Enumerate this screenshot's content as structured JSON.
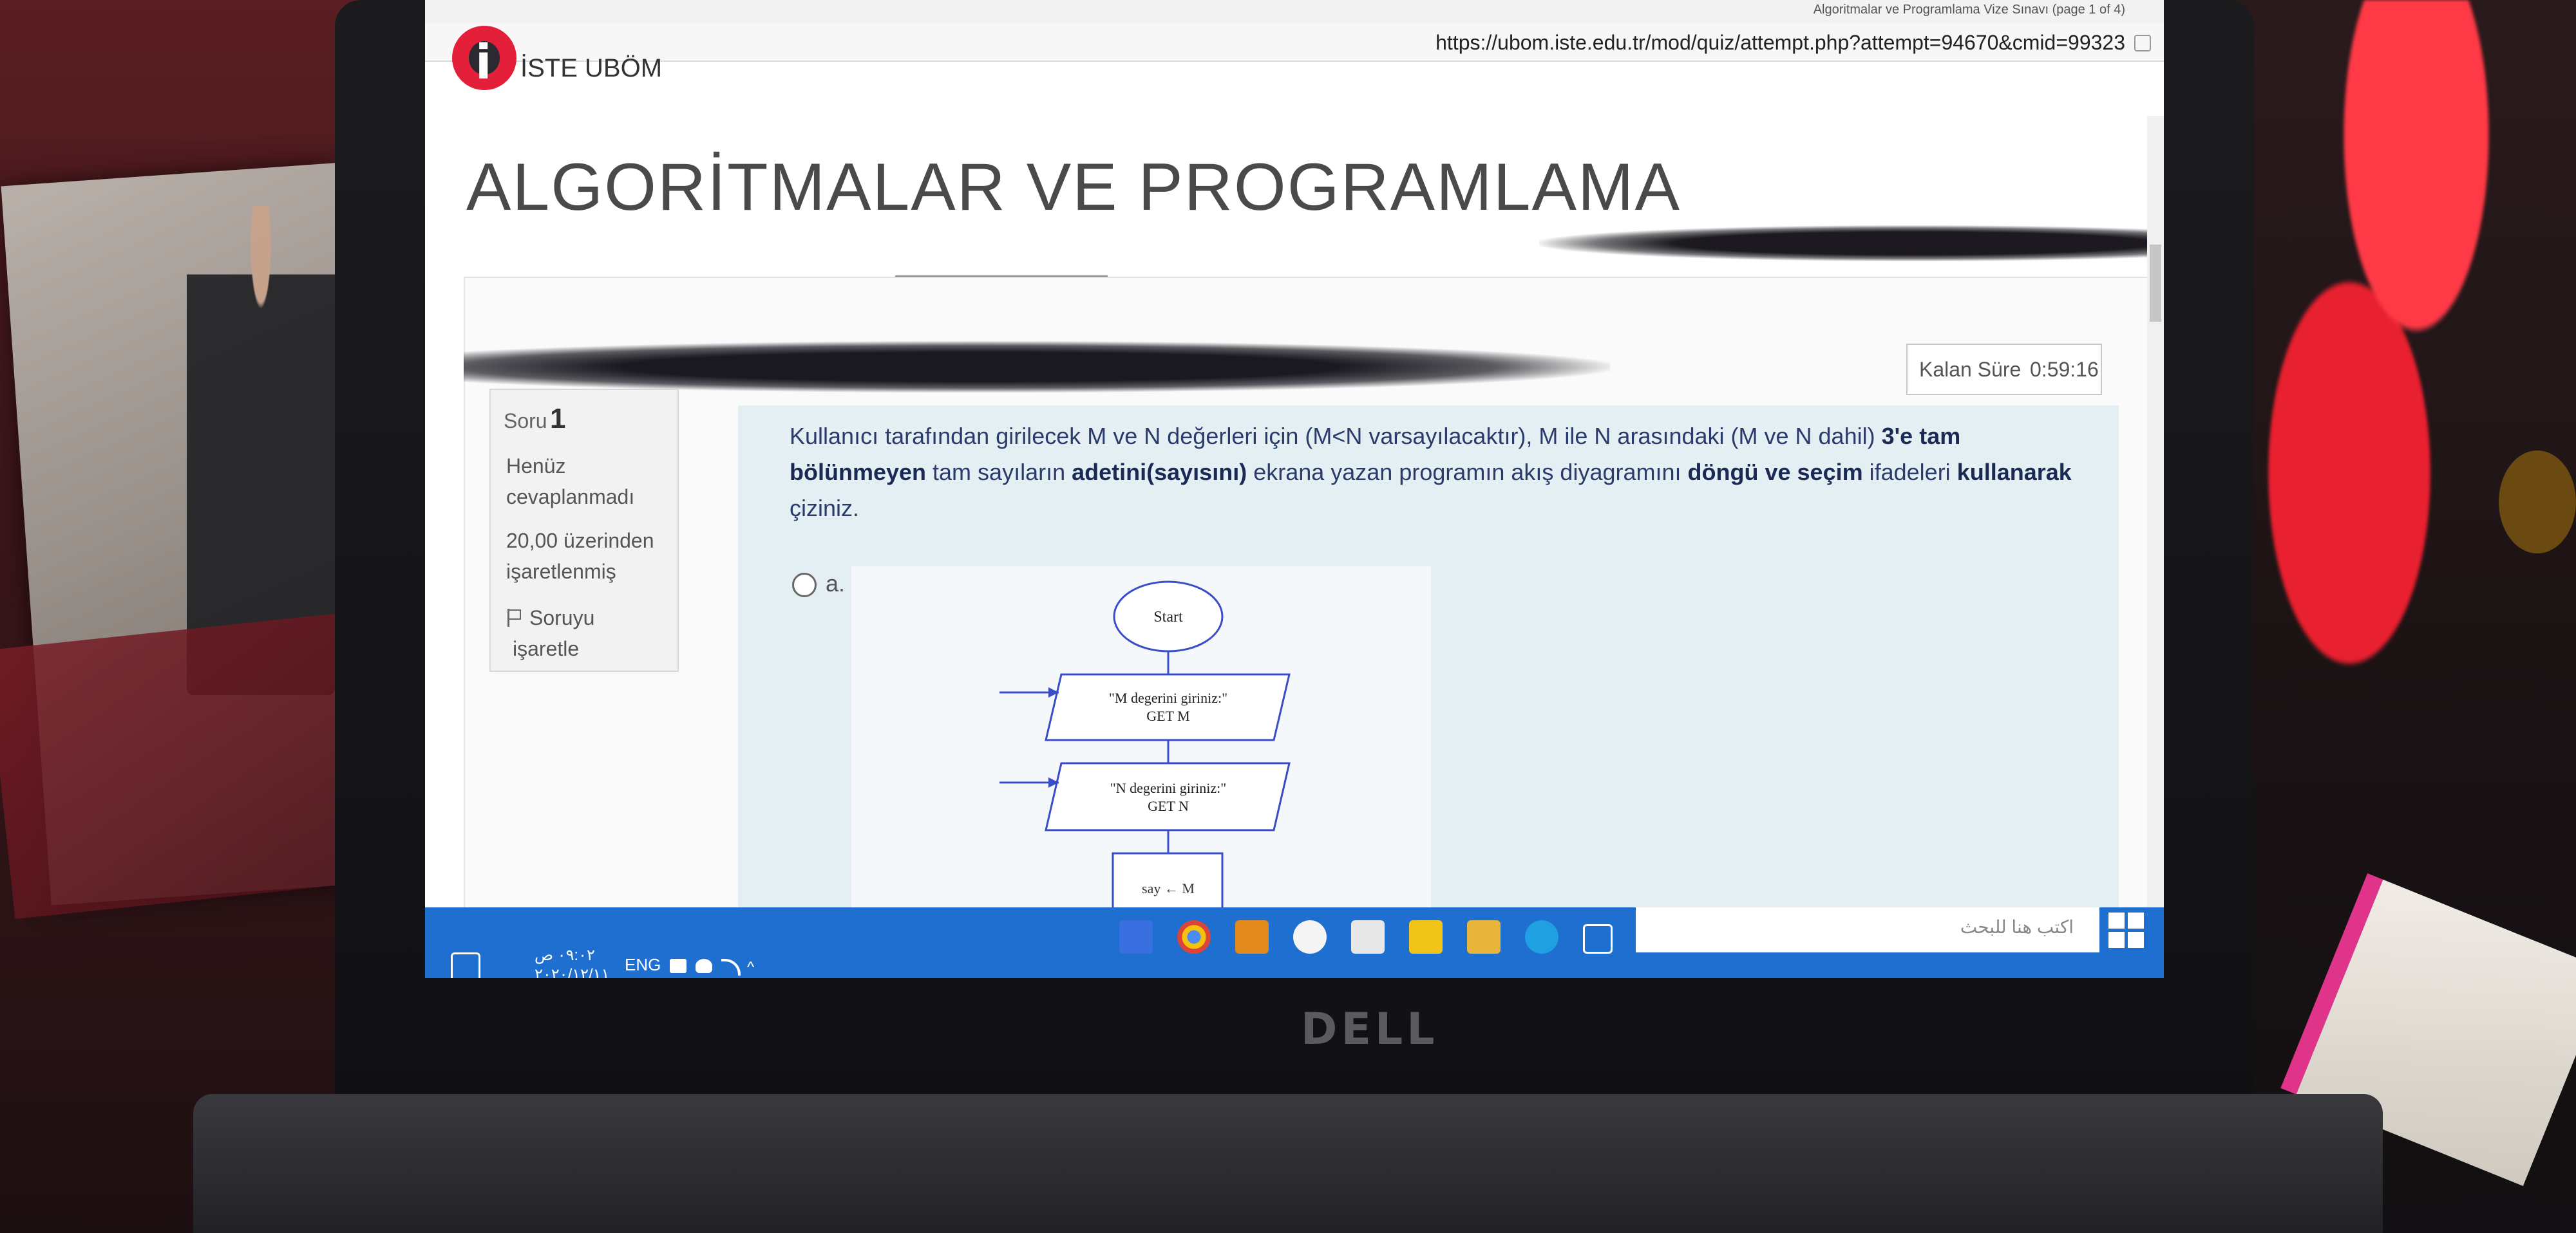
{
  "browser": {
    "tab_title": "Algoritmalar ve Programlama Vize Sınavı (page 1 of 4)",
    "url": "https://ubom.iste.edu.tr/mod/quiz/attempt.php?attempt=94670&cmid=99323"
  },
  "site": {
    "logo_letter": "i",
    "name": "İSTE UBÖM",
    "brand_color": "#e31f3a"
  },
  "course": {
    "title": "ALGORİTMALAR VE PROGRAMLAMA"
  },
  "timer": {
    "label": "Kalan Süre",
    "value": "0:59:16"
  },
  "question_info": {
    "word": "Soru",
    "number": "1",
    "status": "Henüz cevaplanmadı",
    "points": "20,00 üzerinden işaretlenmiş",
    "flag_label": "Soruyu işaretle"
  },
  "question": {
    "part1": "Kullanıcı tarafından girilecek M ve N değerleri için (M<N varsayılacaktır), M ile N arasındaki (M ve N dahil) ",
    "bold1": "3'e tam bölünmeyen",
    "part2": " tam sayıların ",
    "bold2": "adetini(sayısını)",
    "part3": " ekrana yazan programın akış diyagramını ",
    "bold3": "döngü ve seçim",
    "part4": " ifadeleri ",
    "bold4": "kullanarak",
    "part5": " çiziniz."
  },
  "answer_option": {
    "letter": "a."
  },
  "flowchart": {
    "start": "Start",
    "input_m_prompt": "\"M degerini giriniz:\"",
    "input_m_get": "GET M",
    "input_n_prompt": "\"N degerini giriniz:\"",
    "input_n_get": "GET N",
    "assign": "say ← M"
  },
  "taskbar": {
    "search_placeholder": "اكتب هنا للبحث",
    "time": "٠٩:٠٢ ص",
    "date": "٢٠٢٠/١٢/١١",
    "language": "ENG",
    "icons": [
      "vs-code-icon",
      "chrome-icon",
      "media-icon",
      "yahoo-icon",
      "mail-icon",
      "store-icon",
      "files-icon",
      "edge-icon",
      "task-view-icon",
      "cortana-icon"
    ]
  },
  "hardware": {
    "brand": "DELL"
  }
}
